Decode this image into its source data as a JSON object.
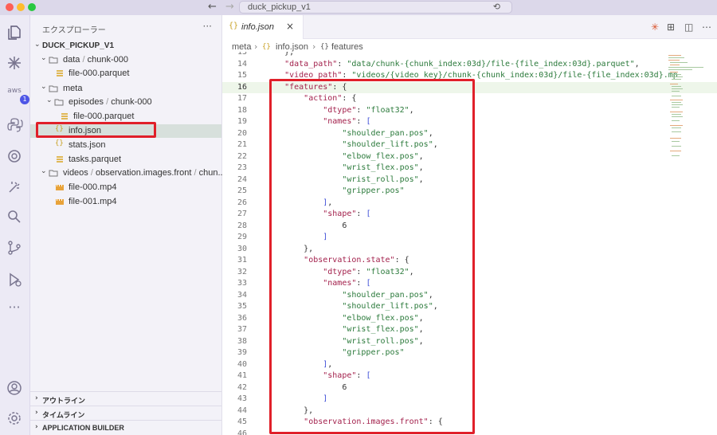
{
  "titlebar": {
    "command_center_text": "duck_pickup_v1",
    "back_icon": "arrow-left-icon",
    "forward_icon": "arrow-right-icon"
  },
  "activity_bar": {
    "items": [
      "files-icon",
      "claude-icon",
      "aws-icon",
      "python-icon",
      "copilot-icon",
      "wand-icon",
      "search-icon",
      "source-control-icon",
      "run-debug-icon",
      "more-icon",
      "account-icon",
      "settings-icon"
    ],
    "aws_badge": "1"
  },
  "sidebar": {
    "title": "エクスプローラー",
    "more": "···",
    "root": "DUCK_PICKUP_V1",
    "tree": [
      {
        "label": "data",
        "label2": "chunk-000"
      },
      {
        "label": "file-000.parquet"
      },
      {
        "label": "meta"
      },
      {
        "label": "episodes",
        "label2": "chunk-000"
      },
      {
        "label": "file-000.parquet"
      },
      {
        "label": "info.json"
      },
      {
        "label": "stats.json"
      },
      {
        "label": "tasks.parquet"
      },
      {
        "label": "videos",
        "label2": "observation.images.front",
        "label3": "chun..."
      },
      {
        "label": "file-000.mp4"
      },
      {
        "label": "file-001.mp4"
      }
    ],
    "sep": "/",
    "sections": [
      "アウトライン",
      "タイムライン",
      "APPLICATION BUILDER"
    ]
  },
  "editor": {
    "tab": {
      "icon": "{}",
      "label": "info.json",
      "close": "×"
    },
    "breadcrumb": {
      "folder": "meta",
      "file": "info.json",
      "symbol": "features",
      "sep": "›",
      "file_icon": "{}",
      "symbol_icon": "{}"
    },
    "toolbar_icons": [
      "sparkle-icon",
      "compare-icon",
      "split-editor-icon",
      "more-actions-icon"
    ],
    "lines": [
      {
        "n": "13",
        "t": "    },"
      },
      {
        "n": "14",
        "t": "    \"data_path\": \"data/chunk-{chunk_index:03d}/file-{file_index:03d}.parquet\","
      },
      {
        "n": "15",
        "t": "    \"video_path\": \"videos/{video_key}/chunk-{chunk_index:03d}/file-{file_index:03d}.mp"
      },
      {
        "n": "16",
        "t": "    \"features\": {"
      },
      {
        "n": "17",
        "t": "        \"action\": {"
      },
      {
        "n": "18",
        "t": "            \"dtype\": \"float32\","
      },
      {
        "n": "19",
        "t": "            \"names\": ["
      },
      {
        "n": "20",
        "t": "                \"shoulder_pan.pos\","
      },
      {
        "n": "21",
        "t": "                \"shoulder_lift.pos\","
      },
      {
        "n": "22",
        "t": "                \"elbow_flex.pos\","
      },
      {
        "n": "23",
        "t": "                \"wrist_flex.pos\","
      },
      {
        "n": "24",
        "t": "                \"wrist_roll.pos\","
      },
      {
        "n": "25",
        "t": "                \"gripper.pos\""
      },
      {
        "n": "26",
        "t": "            ],"
      },
      {
        "n": "27",
        "t": "            \"shape\": ["
      },
      {
        "n": "28",
        "t": "                6"
      },
      {
        "n": "29",
        "t": "            ]"
      },
      {
        "n": "30",
        "t": "        },"
      },
      {
        "n": "31",
        "t": "        \"observation.state\": {"
      },
      {
        "n": "32",
        "t": "            \"dtype\": \"float32\","
      },
      {
        "n": "33",
        "t": "            \"names\": ["
      },
      {
        "n": "34",
        "t": "                \"shoulder_pan.pos\","
      },
      {
        "n": "35",
        "t": "                \"shoulder_lift.pos\","
      },
      {
        "n": "36",
        "t": "                \"elbow_flex.pos\","
      },
      {
        "n": "37",
        "t": "                \"wrist_flex.pos\","
      },
      {
        "n": "38",
        "t": "                \"wrist_roll.pos\","
      },
      {
        "n": "39",
        "t": "                \"gripper.pos\""
      },
      {
        "n": "40",
        "t": "            ],"
      },
      {
        "n": "41",
        "t": "            \"shape\": ["
      },
      {
        "n": "42",
        "t": "                6"
      },
      {
        "n": "43",
        "t": "            ]"
      },
      {
        "n": "44",
        "t": "        },"
      },
      {
        "n": "45",
        "t": "        \"observation.images.front\": {"
      },
      {
        "n": "46",
        "t": ""
      }
    ],
    "current_line": "16"
  },
  "colors": {
    "highlight_box": "#e0202a",
    "selected_row": "#d7e0dc",
    "current_line": "#eef6ea"
  }
}
